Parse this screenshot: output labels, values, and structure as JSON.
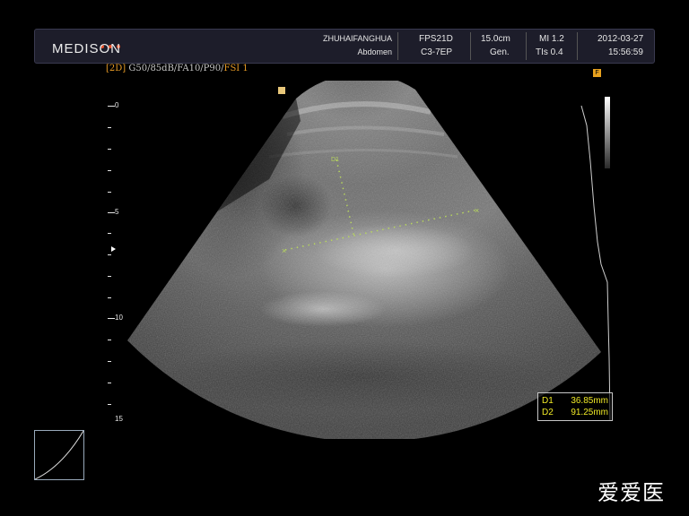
{
  "header": {
    "brand": "MEDISON",
    "hospital": "ZHUHAIFANGHUA",
    "exam": "Abdomen",
    "preset": "FPS21D",
    "probe": "C3-7EP",
    "depth": "15.0cm",
    "mode": "Gen.",
    "mi": "MI 1.2",
    "tis": "TIs 0.4",
    "date": "2012-03-27",
    "time": "15:56:59"
  },
  "imaging": {
    "mode_tag": "[2D]",
    "params": " G50/85dB/FA10/P90/",
    "fsi": "FSI 1"
  },
  "depth_scale": {
    "labels": [
      "0",
      "5",
      "10",
      "15"
    ]
  },
  "measurements": [
    {
      "label": "D1",
      "value": "36.85mm"
    },
    {
      "label": "D2",
      "value": "91.25mm"
    }
  ],
  "focus_marker": "F",
  "caliper_tag": "D1",
  "watermark": "爱爱医",
  "colors": {
    "accent_orange": "#e69a25",
    "measure_yellow": "#f1ea27",
    "caliper_green": "#b7d65e"
  }
}
